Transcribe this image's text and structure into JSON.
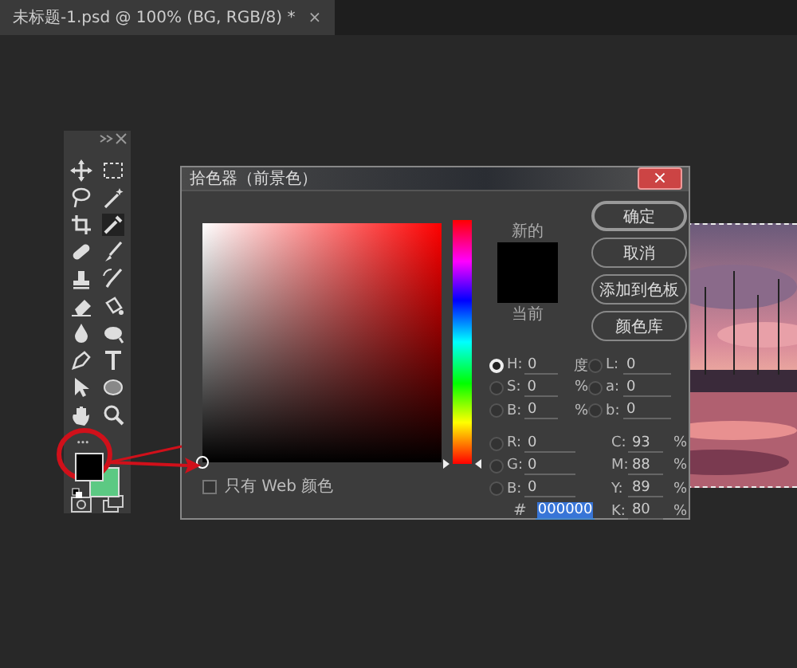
{
  "document_tab": {
    "title": "未标题-1.psd @ 100% (BG, RGB/8) *",
    "close": "×"
  },
  "toolbar": {
    "swatches": [
      {
        "kind": "foreground",
        "color": "#000000"
      },
      {
        "kind": "background",
        "color": "#5cc983"
      }
    ]
  },
  "color_picker": {
    "title": "拾色器（前景色）",
    "close": "×",
    "hue_slider": {
      "level": 0
    },
    "swatches": [
      {
        "label": "新的",
        "color": "#000000"
      },
      {
        "label": "当前",
        "color": "#000000"
      }
    ],
    "buttons": [
      "确定",
      "取消",
      "添加到色板",
      "颜色库"
    ],
    "hsb_rgb": [
      {
        "label": "H:",
        "value": "0",
        "unit": "度",
        "selected": true
      },
      {
        "label": "S:",
        "value": "0",
        "unit": "%",
        "selected": false
      },
      {
        "label": "B:",
        "value": "0",
        "unit": "%",
        "selected": false
      },
      {
        "label": "R:",
        "value": "0",
        "selected": false
      },
      {
        "label": "G:",
        "value": "0",
        "selected": false
      },
      {
        "label": "B:",
        "value": "0",
        "selected": false
      }
    ],
    "lab": [
      {
        "label": "L:",
        "value": "0",
        "selected": false
      },
      {
        "label": "a:",
        "value": "0",
        "selected": false
      },
      {
        "label": "b:",
        "value": "0",
        "selected": false
      }
    ],
    "cmyk": [
      {
        "label": "C:",
        "value": "93",
        "unit": "%"
      },
      {
        "label": "M:",
        "value": "88",
        "unit": "%"
      },
      {
        "label": "Y:",
        "value": "89",
        "unit": "%"
      },
      {
        "label": "K:",
        "value": "80",
        "unit": "%"
      }
    ],
    "hex": {
      "label": "#",
      "value": "000000",
      "highlighted": true
    },
    "web_only": {
      "label": "只有 Web 颜色",
      "checked": false
    }
  }
}
